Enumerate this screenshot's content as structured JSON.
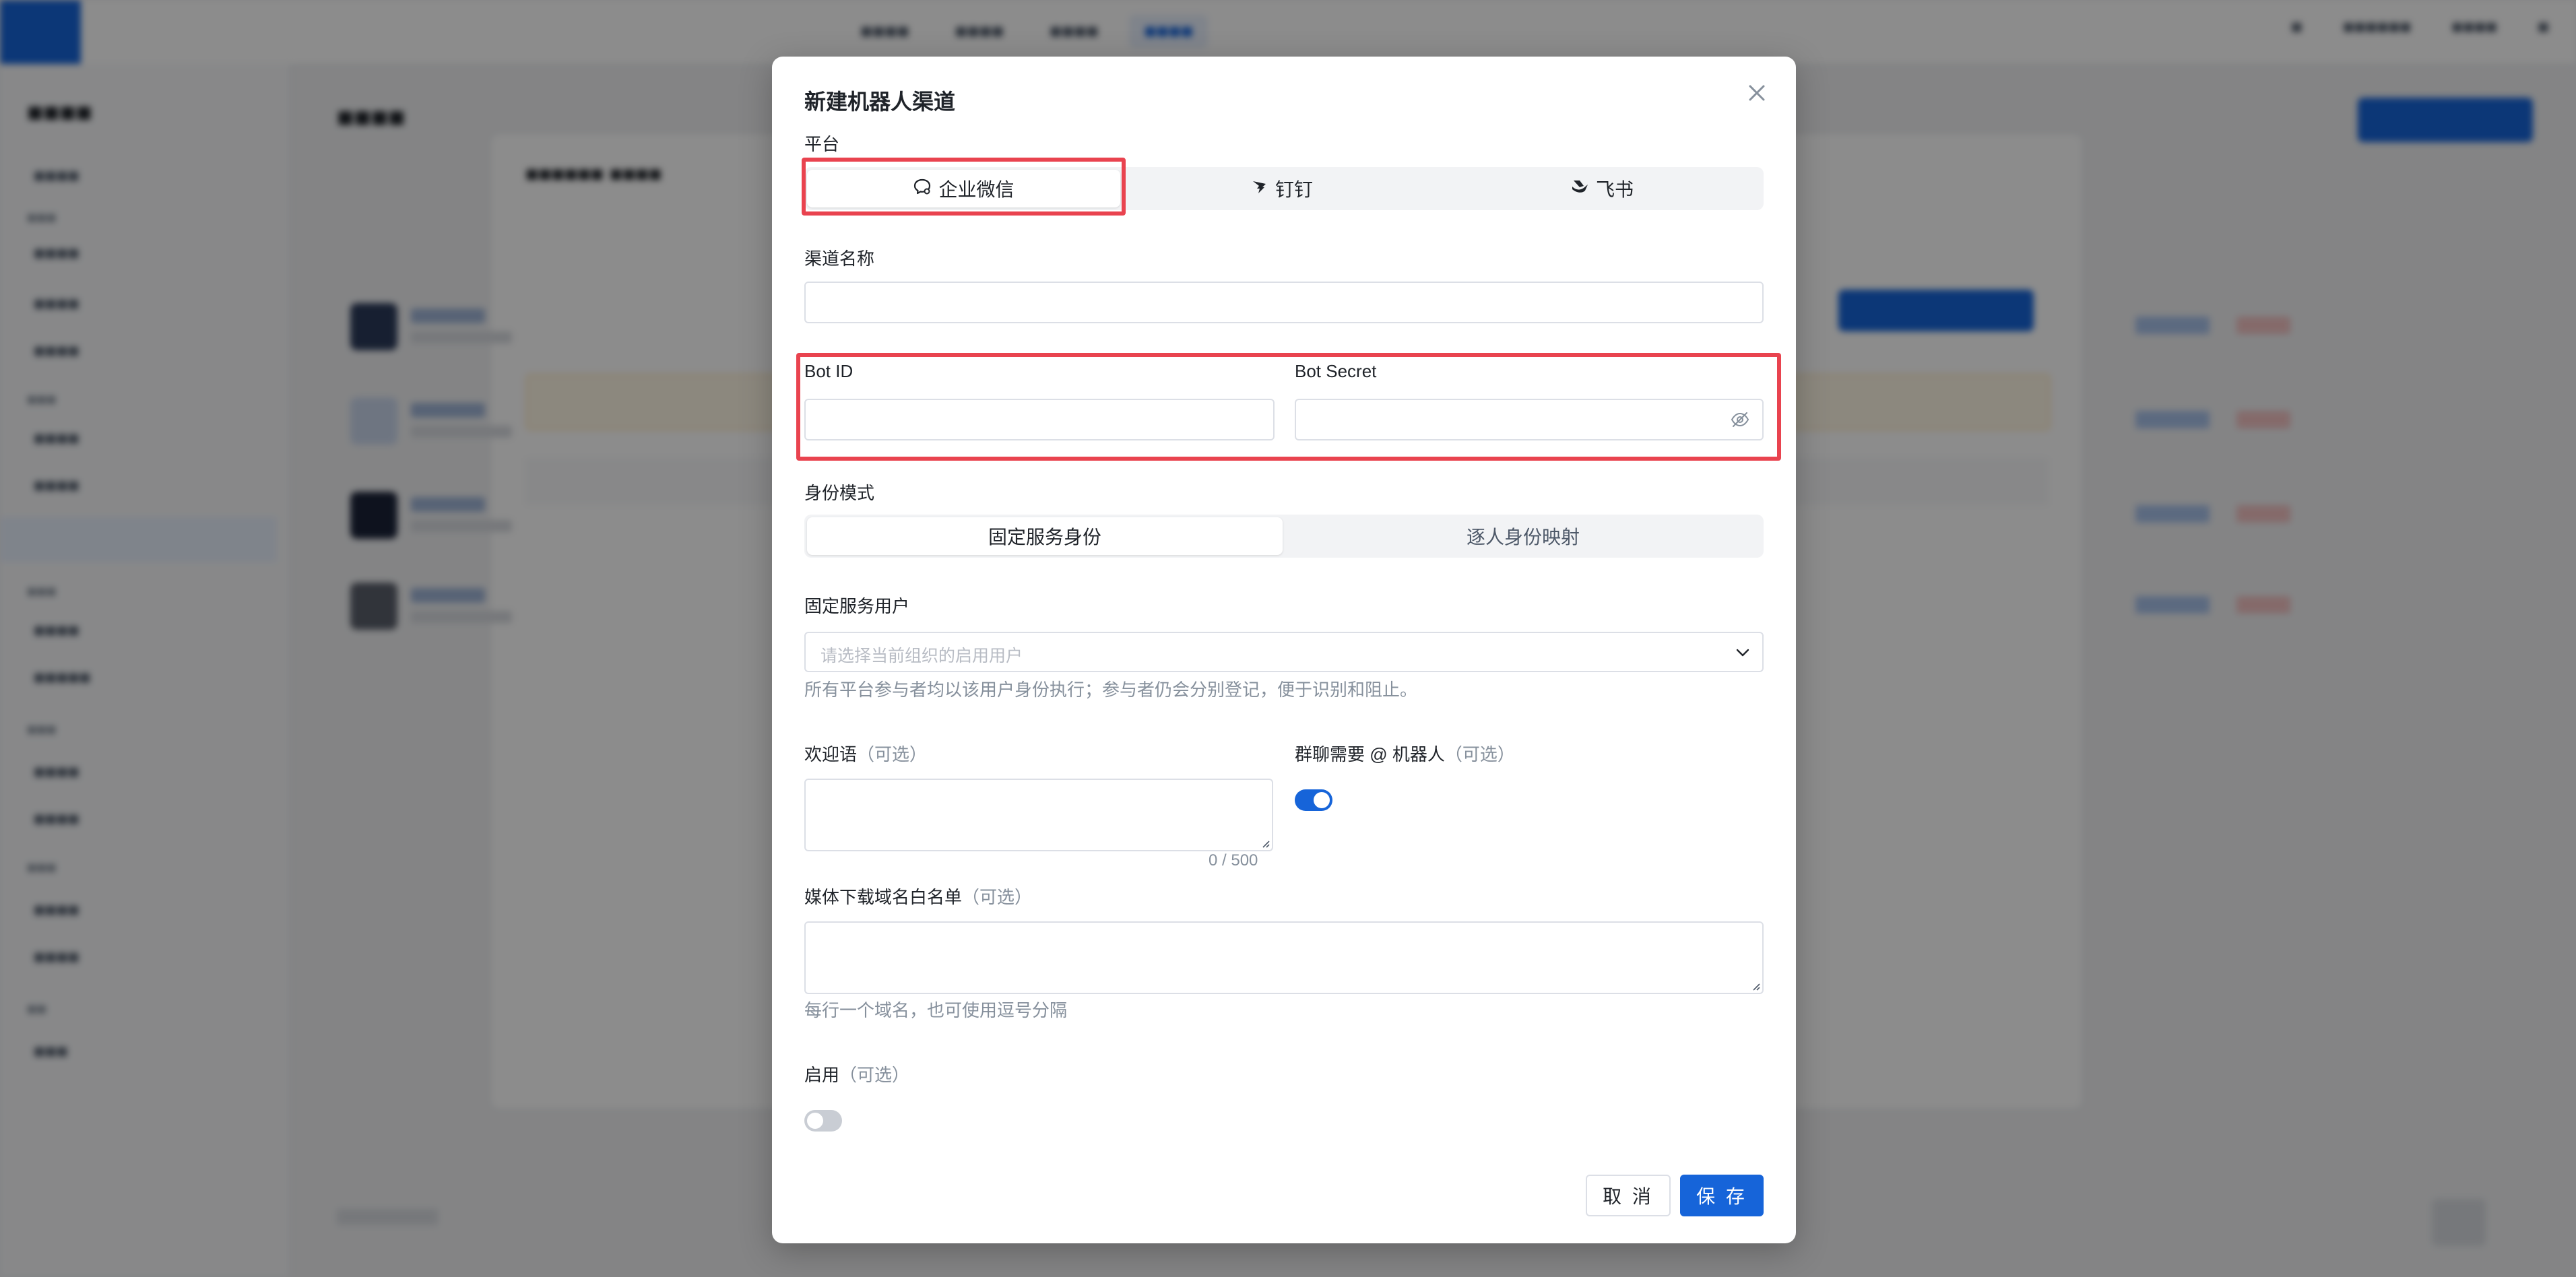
{
  "dialog": {
    "title": "新建机器人渠道",
    "platform_label": "平台",
    "platforms": [
      {
        "label": "企业微信",
        "icon": "chat-bubble-icon"
      },
      {
        "label": "钉钉",
        "icon": "dingtalk-icon"
      },
      {
        "label": "飞书",
        "icon": "feishu-icon"
      }
    ],
    "selected_platform": "企业微信",
    "channel_name_label": "渠道名称",
    "channel_name_value": "",
    "bot_id_label": "Bot ID",
    "bot_id_value": "",
    "bot_secret_label": "Bot Secret",
    "bot_secret_value": "",
    "identity_mode_label": "身份模式",
    "identity_modes": [
      "固定服务身份",
      "逐人身份映射"
    ],
    "identity_mode_selected": "固定服务身份",
    "service_user_label": "固定服务用户",
    "service_user_placeholder": "请选择当前组织的启用用户",
    "service_user_hint": "所有平台参与者均以该用户身份执行；参与者仍会分别登记，便于识别和阻止。",
    "welcome_label": "欢迎语",
    "optional_tag": "（可选）",
    "welcome_value": "",
    "welcome_counter": "0 / 500",
    "group_mention_label": "群聊需要 @ 机器人",
    "group_mention_enabled": true,
    "media_whitelist_label": "媒体下载域名白名单",
    "media_whitelist_value": "",
    "media_whitelist_hint": "每行一个域名，也可使用逗号分隔",
    "enabled_label": "启用",
    "enabled": false,
    "cancel_label": "取 消",
    "save_label": "保 存"
  },
  "colors": {
    "primary": "#1664d9",
    "highlight": "#e9434f",
    "overlay": "rgba(0,0,0,0.45)"
  }
}
